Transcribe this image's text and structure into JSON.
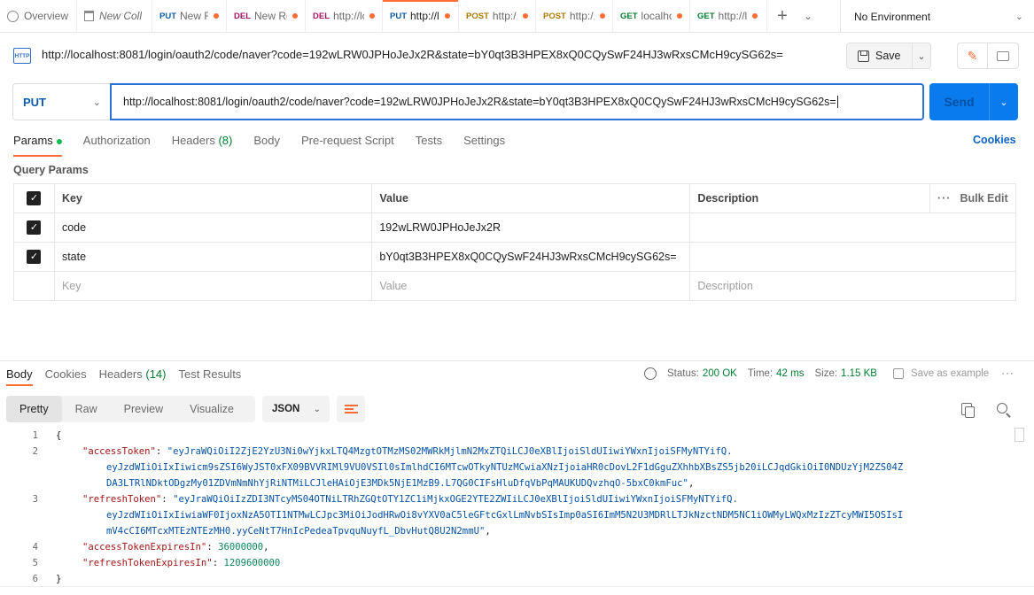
{
  "tabs": [
    {
      "method": "",
      "title": "Overview",
      "kind": "overview",
      "dirty": false
    },
    {
      "method": "",
      "title": "New Coll",
      "kind": "collection",
      "dirty": false
    },
    {
      "method": "PUT",
      "title": "New Re",
      "kind": "put",
      "dirty": true
    },
    {
      "method": "DEL",
      "title": "New Re",
      "kind": "del",
      "dirty": true
    },
    {
      "method": "DEL",
      "title": "http://lc",
      "kind": "del",
      "dirty": true
    },
    {
      "method": "PUT",
      "title": "http://l",
      "kind": "put",
      "dirty": true,
      "active": true
    },
    {
      "method": "POST",
      "title": "http:/,",
      "kind": "post",
      "dirty": true
    },
    {
      "method": "POST",
      "title": "http:/,",
      "kind": "post",
      "dirty": true
    },
    {
      "method": "GET",
      "title": "localho",
      "kind": "get",
      "dirty": true
    },
    {
      "method": "GET",
      "title": "http://l",
      "kind": "get",
      "dirty": true
    }
  ],
  "environment": "No Environment",
  "request": {
    "icon_label": "HTTP",
    "title": "http://localhost:8081/login/oauth2/code/naver?code=192wLRW0JPHoJeJx2R&state=bY0qt3B3HPEX8xQ0CQySwF24HJ3wRxsCMcH9cySG62s=",
    "save_label": "Save",
    "method": "PUT",
    "url": "http://localhost:8081/login/oauth2/code/naver?code=192wLRW0JPHoJeJx2R&state=bY0qt3B3HPEX8xQ0CQySwF24HJ3wRxsCMcH9cySG62s=",
    "send_label": "Send"
  },
  "request_tabs": {
    "params": "Params",
    "authorization": "Authorization",
    "headers": "Headers",
    "headers_count": "(8)",
    "body": "Body",
    "prerequest": "Pre-request Script",
    "tests": "Tests",
    "settings": "Settings",
    "cookies": "Cookies"
  },
  "query_params": {
    "title": "Query Params",
    "headers": {
      "key": "Key",
      "value": "Value",
      "description": "Description",
      "bulk_edit": "Bulk Edit"
    },
    "rows": [
      {
        "key": "code",
        "value": "192wLRW0JPHoJeJx2R"
      },
      {
        "key": "state",
        "value": "bY0qt3B3HPEX8xQ0CQySwF24HJ3wRxsCMcH9cySG62s="
      }
    ],
    "placeholder": {
      "key": "Key",
      "value": "Value",
      "description": "Description"
    }
  },
  "response": {
    "tabs": {
      "body": "Body",
      "cookies": "Cookies",
      "headers": "Headers",
      "headers_count": "(14)",
      "test_results": "Test Results"
    },
    "status_label": "Status:",
    "status_value": "200 OK",
    "time_label": "Time:",
    "time_value": "42 ms",
    "size_label": "Size:",
    "size_value": "1.15 KB",
    "save_example": "Save as example",
    "views": [
      "Pretty",
      "Raw",
      "Preview",
      "Visualize"
    ],
    "format": "JSON",
    "code": {
      "l1": "{",
      "access_key": "\"accessToken\"",
      "access_p1": "\"eyJraWQiOiI2ZjE2YzU3Ni0wYjkxLTQ4MzgtOTMzMS02MWRkMjlmN2MxZTQiLCJ0eXBlIjoiSldUIiwiYWxnIjoiSFMyNTYifQ.",
      "access_p2": "eyJzdWIiOiIxIiwicm9sZSI6WyJST0xFX09BVVRIMl9VU0VSIl0sImlhdCI6MTcwOTkyNTUzMCwiaXNzIjoiaHR0cDovL2F1dGguZXhhbXBsZS5jb20iLCJqdGkiOiI0NDUzYjM2ZS04Z",
      "access_p3": "DA3LTRlNDktODgzMy01ZDVmNmNhYjRiNTMiLCJleHAiOjE3MDk5NjE1MzB9.L7QG0CIFsHluDfqVbPqMAUKUDQvzhqO-5bxC0kmFuc\"",
      "refresh_key": "\"refreshToken\"",
      "refresh_p1": "\"eyJraWQiOiIzZDI3NTcyMS04OTNiLTRhZGQtOTY1ZC1iMjkxOGE2YTE2ZWIiLCJ0eXBlIjoiSldUIiwiYWxnIjoiSFMyNTYifQ.",
      "refresh_p2": "eyJzdWIiOiIxIiwiaWF0IjoxNzA5OTI1NTMwLCJpc3MiOiJodHRwOi8vYXV0aC5leGFtcGxlLmNvbSIsImp0aSI6ImM5N2U3MDRlLTJkNzctNDM5NC1iOWMyLWQxMzIzZTcyMWI5OSIsI",
      "refresh_p3": "mV4cCI6MTcxMTEzNTEzMH0.yyCeNtT7HnIcPedeaTpvquNuyfL_DbvHutQ8U2N2mmU\"",
      "ate_key": "\"accessTokenExpiresIn\"",
      "ate_val": "36000000",
      "rte_key": "\"refreshTokenExpiresIn\"",
      "rte_val": "1209600000",
      "l6": "}"
    }
  },
  "colors": {
    "accent": "#ff6c37",
    "send": "#097bed",
    "put": "#0b5cad",
    "get": "#007f31",
    "post": "#ad7a03",
    "del": "#a61468"
  }
}
